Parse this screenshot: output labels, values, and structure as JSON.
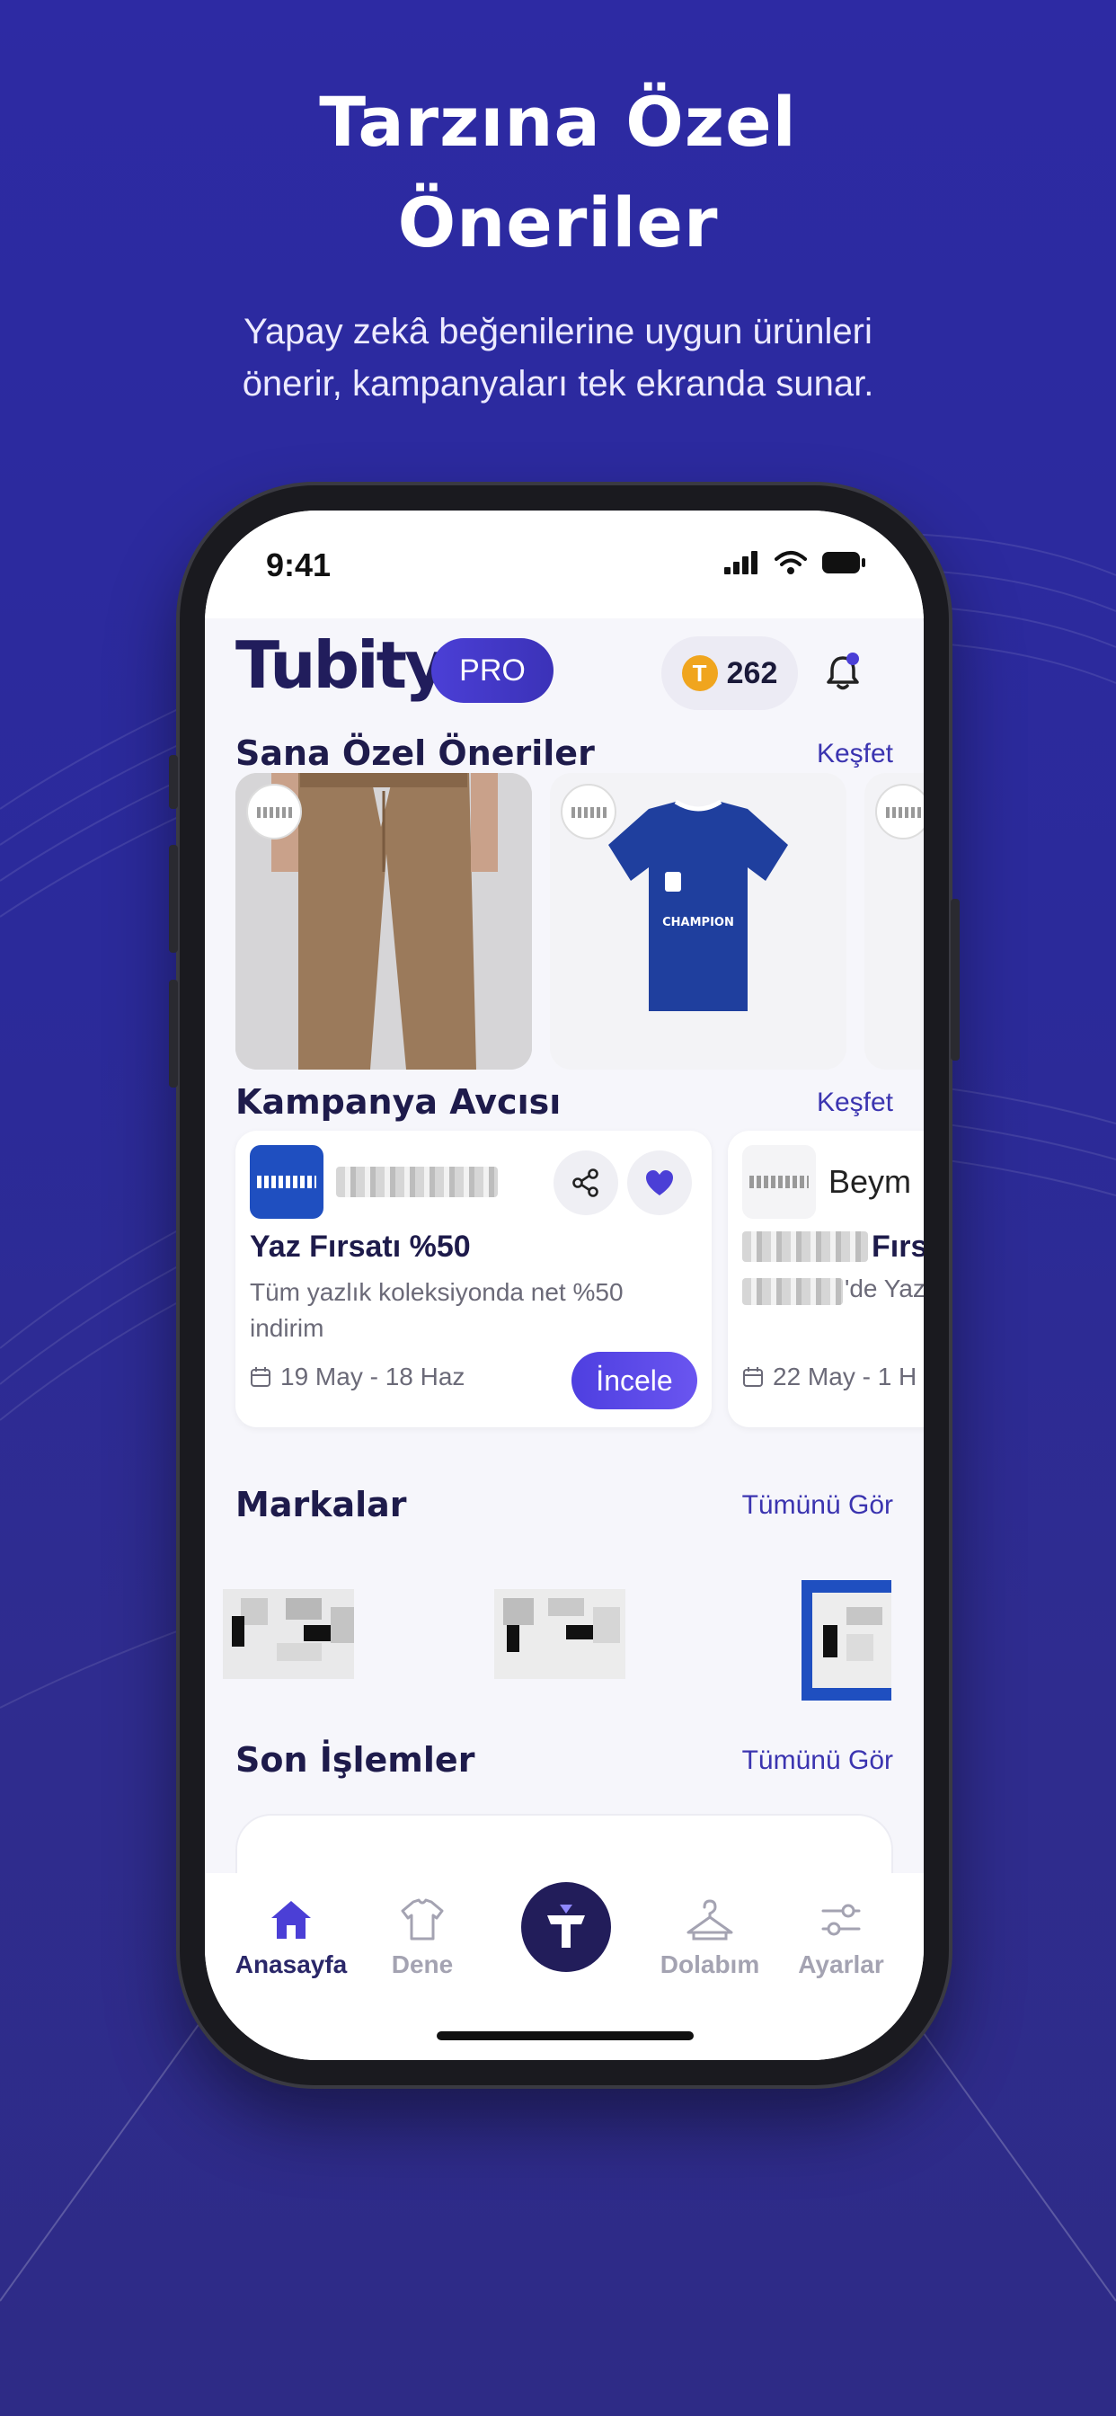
{
  "hero": {
    "title_line1": "Tarzına Özel",
    "title_line2": "Öneriler",
    "subtitle_line1": "Yapay zekâ beğenilerine uygun ürünleri",
    "subtitle_line2": "önerir, kampanyaları tek ekranda sunar."
  },
  "status_bar": {
    "time": "9:41"
  },
  "header": {
    "logo": "Tubity",
    "badge": "PRO",
    "coin_count": "262"
  },
  "recommendations": {
    "title": "Sana Özel Öneriler",
    "link": "Keşfet",
    "items": [
      {
        "name": "brown-trousers"
      },
      {
        "name": "blue-tshirt",
        "print": "CHAMPION"
      },
      {
        "name": "partial-item"
      }
    ]
  },
  "campaigns": {
    "title": "Kampanya Avcısı",
    "link": "Keşfet",
    "items": [
      {
        "title": "Yaz Fırsatı %50",
        "description": "Tüm yazlık koleksiyonda net %50 indirim",
        "date": "19 May - 18 Haz",
        "button": "İncele"
      },
      {
        "brand": "Beym",
        "title": "Fırs",
        "description": "'de Yaz",
        "date": "22 May - 1 H"
      }
    ]
  },
  "brands": {
    "title": "Markalar",
    "link": "Tümünü Gör"
  },
  "recent": {
    "title": "Son İşlemler",
    "link": "Tümünü Gör"
  },
  "tabbar": {
    "home": "Anasayfa",
    "try": "Dene",
    "closet": "Dolabım",
    "settings": "Ayarlar"
  },
  "colors": {
    "background": "#2d2aa3",
    "accent": "#4b3fd6",
    "heading": "#1e1b4b",
    "link": "#3b34b0",
    "coin": "#f0a51e"
  }
}
